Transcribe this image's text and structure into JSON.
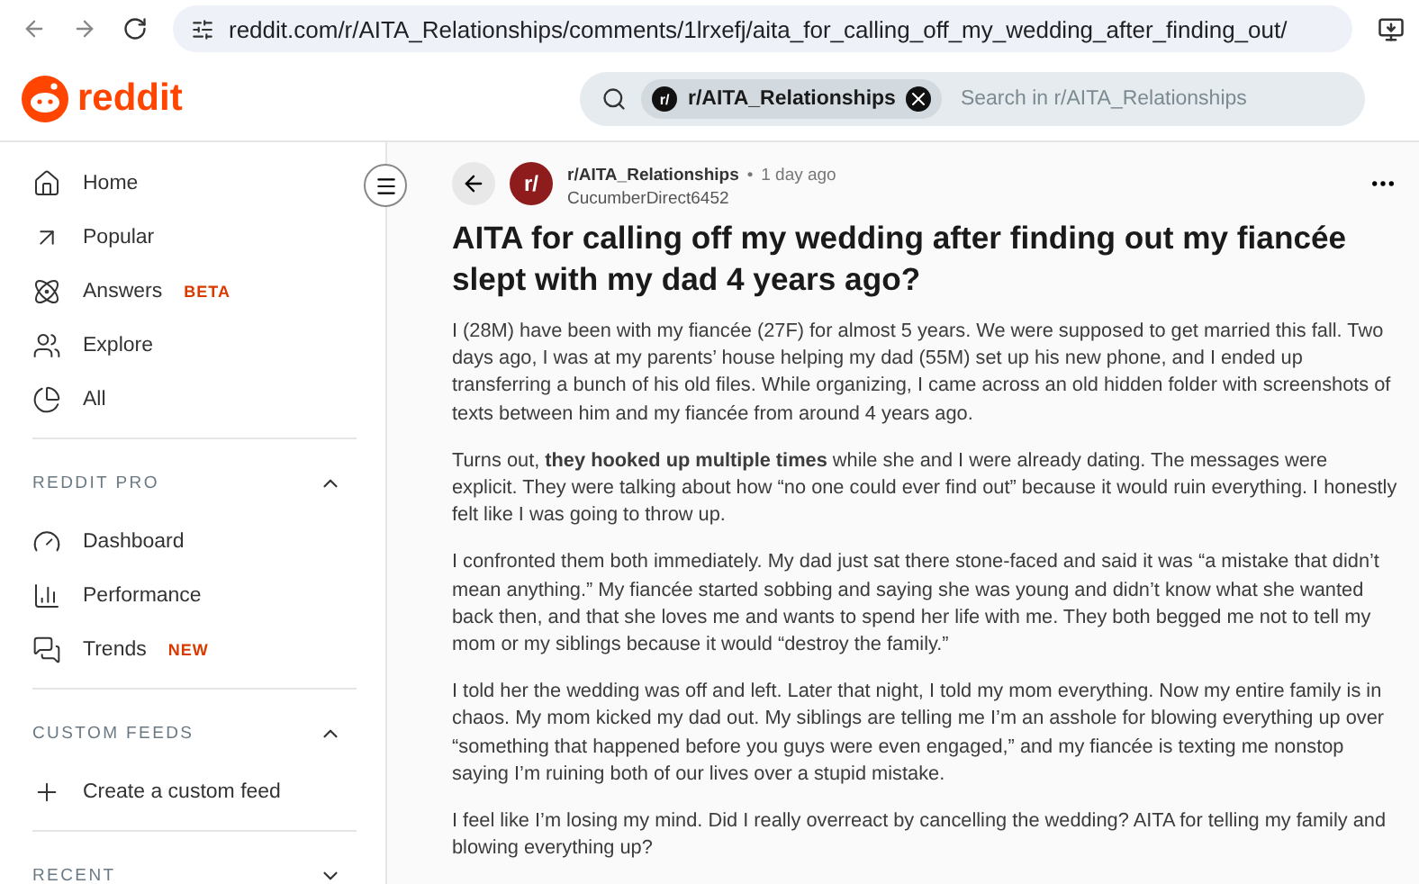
{
  "browser": {
    "url": "reddit.com/r/AITA_Relationships/comments/1lrxefj/aita_for_calling_off_my_wedding_after_finding_out/"
  },
  "header": {
    "logo": "reddit",
    "search": {
      "chip_icon": "r/",
      "chip": "r/AITA_Relationships",
      "placeholder": "Search in r/AITA_Relationships"
    }
  },
  "sidebar": {
    "items": [
      {
        "label": "Home"
      },
      {
        "label": "Popular"
      },
      {
        "label": "Answers",
        "badge": "BETA"
      },
      {
        "label": "Explore"
      },
      {
        "label": "All"
      }
    ],
    "sections": [
      {
        "title": "REDDIT PRO",
        "expanded": true,
        "items": [
          {
            "label": "Dashboard"
          },
          {
            "label": "Performance"
          },
          {
            "label": "Trends",
            "badge": "NEW"
          }
        ]
      },
      {
        "title": "CUSTOM FEEDS",
        "expanded": true,
        "items": [
          {
            "label": "Create a custom feed"
          }
        ]
      },
      {
        "title": "RECENT",
        "expanded": false
      }
    ]
  },
  "post": {
    "subreddit": "r/AITA_Relationships",
    "avatar": "r/",
    "separator": "•",
    "time": "1 day ago",
    "author": "CucumberDirect6452",
    "title": "AITA for calling off my wedding after finding out my fiancée slept with my dad 4 years ago?",
    "paragraphs": [
      "I (28M) have been with my fiancée (27F) for almost 5 years. We were supposed to get married this fall. Two days ago, I was at my parents’ house helping my dad (55M) set up his new phone, and I ended up transferring a bunch of his old files. While organizing, I came across an old hidden folder with screenshots of texts between him and my fiancée from around 4 years ago.",
      "Turns out, **they hooked up multiple times** while she and I were already dating. The messages were explicit. They were talking about how “no one could ever find out” because it would ruin everything. I honestly felt like I was going to throw up.",
      "I confronted them both immediately. My dad just sat there stone-faced and said it was “a mistake that didn’t mean anything.” My fiancée started sobbing and saying she was young and didn’t know what she wanted back then, and that she loves me and wants to spend her life with me. They both begged me not to tell my mom or my siblings because it would “destroy the family.”",
      "I told her the wedding was off and left. Later that night, I told my mom everything. Now my entire family is in chaos. My mom kicked my dad out. My siblings are telling me I’m an asshole for blowing everything up over “something that happened before you guys were even engaged,” and my fiancée is texting me nonstop saying I’m ruining both of our lives over a stupid mistake.",
      "I feel like I’m losing my mind. Did I really overreact by cancelling the wedding? AITA for telling my family and blowing everything up?"
    ]
  }
}
